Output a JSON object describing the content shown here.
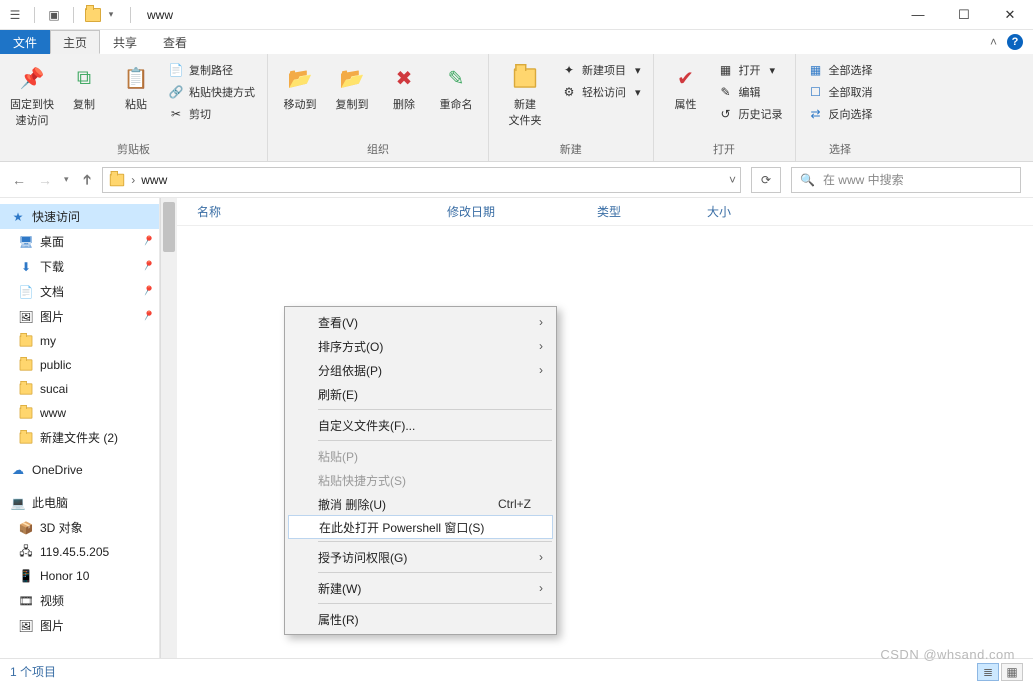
{
  "title": "www",
  "tabs": {
    "file": "文件",
    "home": "主页",
    "share": "共享",
    "view": "查看"
  },
  "ribbon": {
    "clipboard": {
      "label": "剪贴板",
      "pinQuick": "固定到快\n速访问",
      "copy": "复制",
      "paste": "粘贴",
      "copyPath": "复制路径",
      "pasteShortcut": "粘贴快捷方式",
      "cut": "剪切"
    },
    "organize": {
      "label": "组织",
      "moveTo": "移动到",
      "copyTo": "复制到",
      "delete": "删除",
      "rename": "重命名"
    },
    "new_": {
      "label": "新建",
      "newFolder": "新建\n文件夹",
      "newItem": "新建项目",
      "easyAccess": "轻松访问"
    },
    "open": {
      "label": "打开",
      "properties": "属性",
      "open": "打开",
      "edit": "编辑",
      "history": "历史记录"
    },
    "select": {
      "label": "选择",
      "selectAll": "全部选择",
      "selectNone": "全部取消",
      "invert": "反向选择"
    }
  },
  "address": {
    "path": "www",
    "searchPlaceholder": "在 www 中搜索"
  },
  "columns": {
    "name": "名称",
    "modified": "修改日期",
    "type": "类型",
    "size": "大小"
  },
  "nav": {
    "quickAccess": "快速访问",
    "desktop": "桌面",
    "downloads": "下载",
    "documents": "文档",
    "pictures": "图片",
    "my": "my",
    "public": "public",
    "sucai": "sucai",
    "www": "www",
    "newFolder2": "新建文件夹 (2)",
    "oneDrive": "OneDrive",
    "thisPC": "此电脑",
    "objects3d": "3D 对象",
    "ipAddr": "119.45.5.205",
    "honor10": "Honor 10",
    "videos": "视频",
    "picsPC": "图片"
  },
  "status": {
    "items": "1 个项目"
  },
  "watermark": "CSDN @whsand.com",
  "context": {
    "view": "查看(V)",
    "sort": "排序方式(O)",
    "group": "分组依据(P)",
    "refresh": "刷新(E)",
    "customize": "自定义文件夹(F)...",
    "paste": "粘贴(P)",
    "pasteShortcut": "粘贴快捷方式(S)",
    "undoDelete": "撤消 删除(U)",
    "undoShortcut": "Ctrl+Z",
    "openPowershell": "在此处打开 Powershell 窗口(S)",
    "giveAccess": "授予访问权限(G)",
    "new_": "新建(W)",
    "properties": "属性(R)"
  }
}
